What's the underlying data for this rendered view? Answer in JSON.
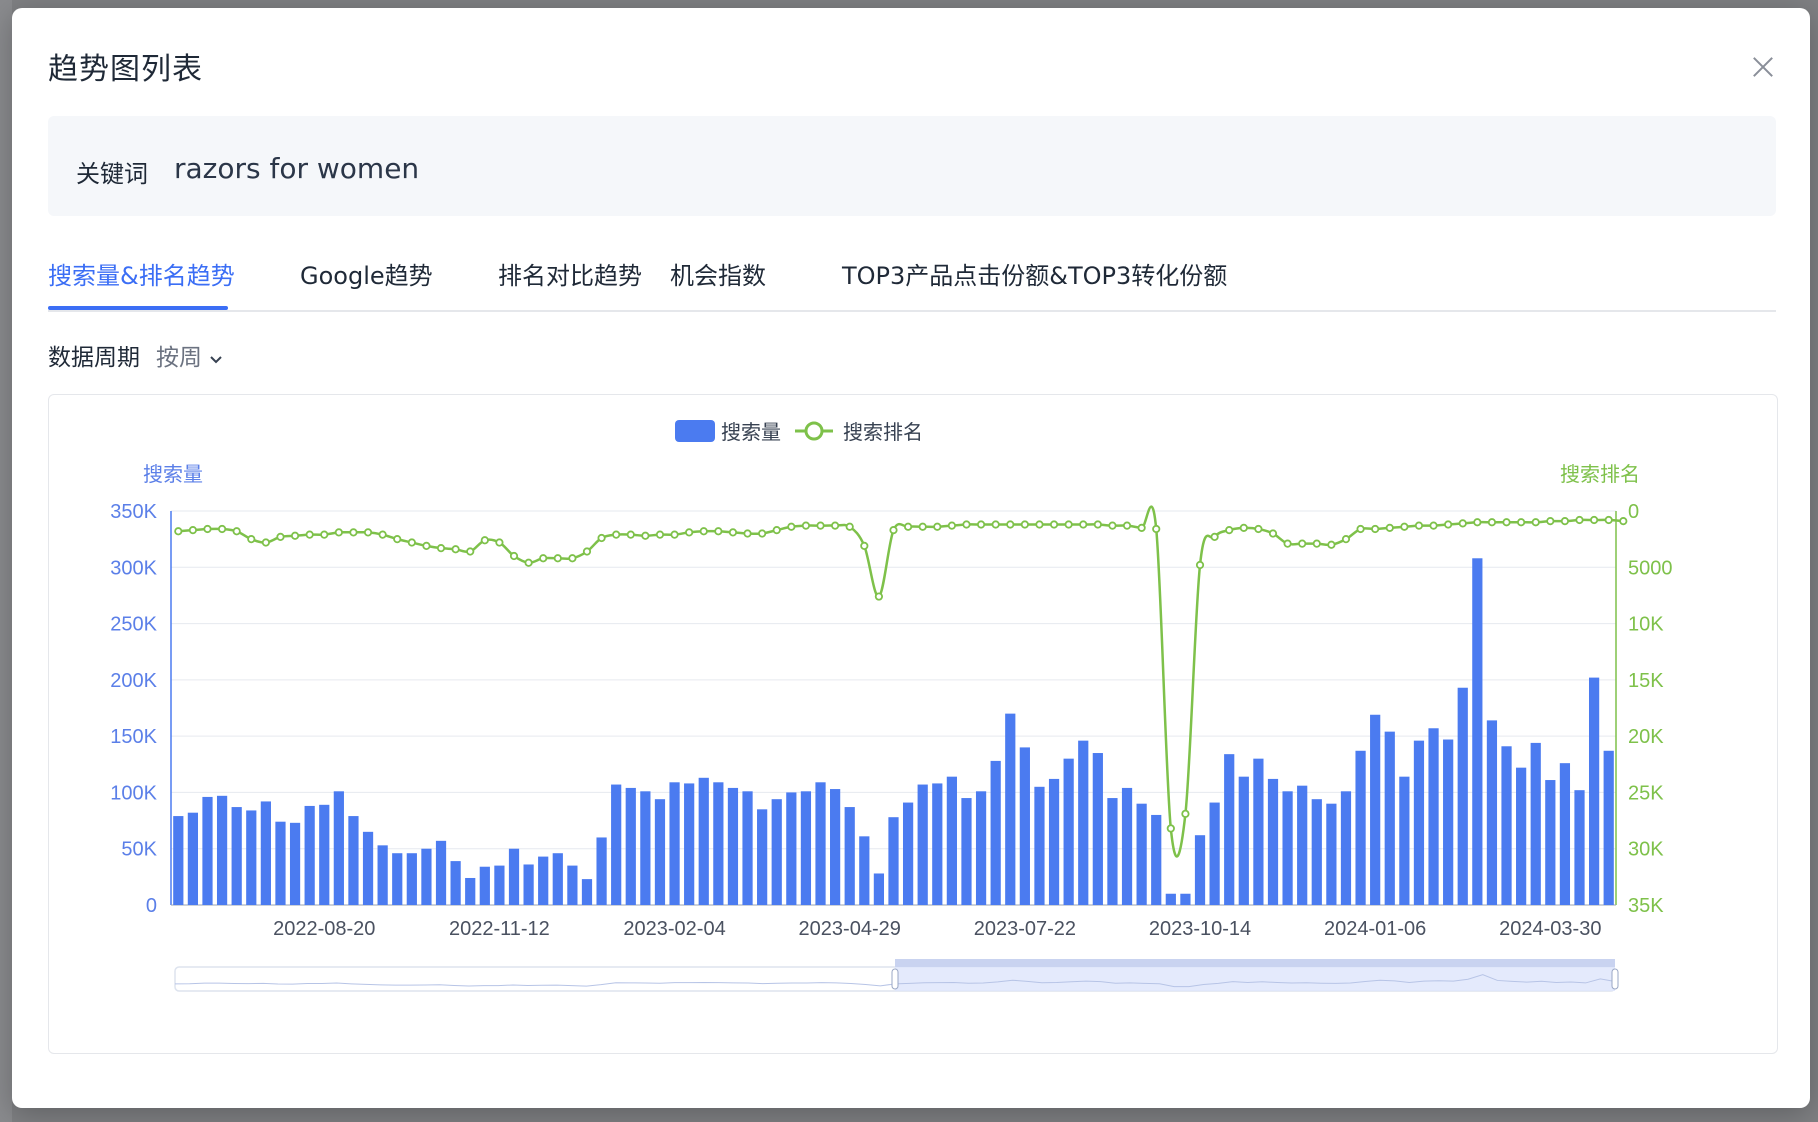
{
  "modal": {
    "title": "趋势图列表",
    "keyword_label": "关键词",
    "keyword_value": "razors for women"
  },
  "tabs": [
    {
      "label": "搜索量&排名趋势",
      "active": true
    },
    {
      "label": "Google趋势",
      "active": false
    },
    {
      "label": "排名对比趋势",
      "active": false
    },
    {
      "label": "机会指数",
      "active": false
    },
    {
      "label": "TOP3产品点击份额&TOP3转化份额",
      "active": false
    }
  ],
  "period": {
    "label": "数据周期",
    "selected": "按周"
  },
  "colors": {
    "accent": "#3b6ef5",
    "bar": "#4b7bf0",
    "line": "#7ec14a"
  },
  "chart_data": {
    "type": "bar+line",
    "legend": [
      "搜索量",
      "搜索排名"
    ],
    "legend_position": "top-center",
    "y_left": {
      "label": "搜索量",
      "ticks": [
        "0",
        "50K",
        "100K",
        "150K",
        "200K",
        "250K",
        "300K",
        "350K"
      ],
      "range": [
        0,
        350000
      ]
    },
    "y_right": {
      "label": "搜索排名",
      "ticks": [
        "0",
        "5000",
        "10K",
        "15K",
        "20K",
        "25K",
        "30K",
        "35K"
      ],
      "range": [
        0,
        35000
      ],
      "inverted": true
    },
    "x_tick_labels": [
      "2022-08-20",
      "2022-11-12",
      "2023-02-04",
      "2023-04-29",
      "2023-07-22",
      "2023-10-14",
      "2024-01-06",
      "2024-03-30"
    ],
    "x_tick_positions": [
      10,
      22,
      34,
      46,
      58,
      70,
      82,
      94
    ],
    "grid": true,
    "series": [
      {
        "name": "搜索量",
        "type": "bar",
        "values": [
          79000,
          82000,
          96000,
          97000,
          87000,
          84000,
          92000,
          74000,
          73000,
          88000,
          89000,
          101000,
          79000,
          65000,
          53000,
          46000,
          46000,
          50000,
          57000,
          39000,
          24000,
          34000,
          35000,
          50000,
          36000,
          43000,
          46000,
          35000,
          23000,
          60000,
          107000,
          104000,
          101000,
          94000,
          109000,
          108000,
          113000,
          109000,
          104000,
          101000,
          85000,
          94000,
          100000,
          101000,
          109000,
          103000,
          87000,
          61000,
          28000,
          78000,
          91000,
          107000,
          108000,
          114000,
          95000,
          101000,
          128000,
          170000,
          140000,
          105000,
          112000,
          130000,
          146000,
          135000,
          95000,
          104000,
          90000,
          80000,
          10000,
          10000,
          62000,
          91000,
          134000,
          114000,
          130000,
          112000,
          101000,
          106000,
          94000,
          90000,
          101000,
          137000,
          169000,
          154000,
          114000,
          146000,
          157000,
          147000,
          193000,
          308000,
          164000,
          141000,
          122000,
          144000,
          111000,
          126000,
          102000,
          202000,
          137000
        ]
      },
      {
        "name": "搜索排名",
        "type": "line",
        "values": [
          1800,
          1700,
          1600,
          1600,
          1800,
          2500,
          2800,
          2300,
          2200,
          2100,
          2100,
          1900,
          1900,
          1900,
          2100,
          2500,
          2800,
          3100,
          3300,
          3400,
          3600,
          2600,
          2800,
          4000,
          4600,
          4200,
          4200,
          4200,
          3600,
          2400,
          2100,
          2100,
          2200,
          2100,
          2100,
          1900,
          1800,
          1800,
          1900,
          2000,
          2000,
          1700,
          1400,
          1300,
          1300,
          1300,
          1400,
          3100,
          7600,
          1700,
          1400,
          1400,
          1400,
          1300,
          1200,
          1200,
          1200,
          1200,
          1200,
          1200,
          1200,
          1200,
          1200,
          1200,
          1300,
          1300,
          1500,
          1600,
          28200,
          26900,
          4800,
          2300,
          1700,
          1500,
          1600,
          2000,
          2900,
          2900,
          2900,
          3000,
          2500,
          1600,
          1600,
          1500,
          1400,
          1300,
          1300,
          1200,
          1100,
          1000,
          1000,
          1000,
          1000,
          1000,
          900,
          900,
          800,
          800,
          800,
          900
        ]
      }
    ]
  }
}
